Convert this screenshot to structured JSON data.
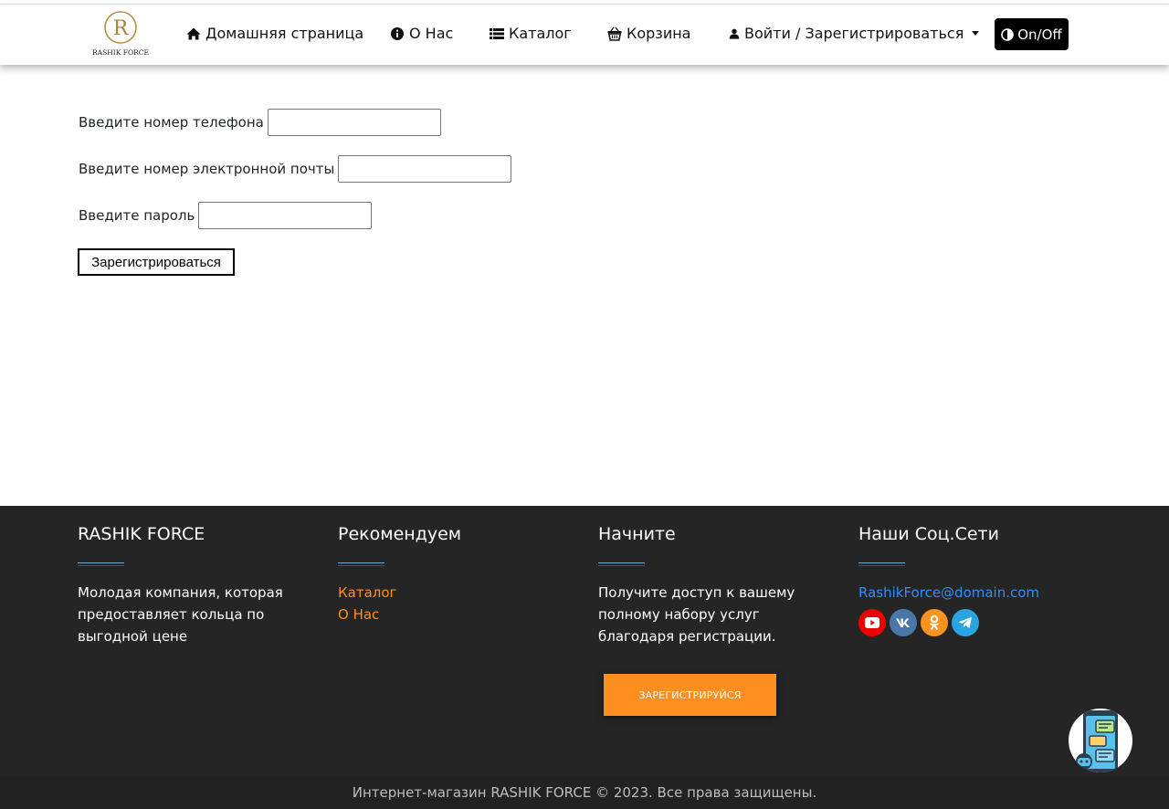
{
  "header": {
    "logo_text": "RASHIK FORCE",
    "nav": [
      {
        "label": "Домашняя страница",
        "icon": "home-icon"
      },
      {
        "label": "О Нас",
        "icon": "info-icon"
      },
      {
        "label": "Каталог",
        "icon": "list-icon"
      },
      {
        "label": "Корзина",
        "icon": "basket-icon"
      },
      {
        "label": "Войти / Зарегистрироваться",
        "icon": "user-icon"
      }
    ],
    "toggle_label": "On/Off"
  },
  "form": {
    "phone_label": "Введите номер телефона",
    "phone_value": "",
    "email_label": "Введите номер электронной почты",
    "email_value": "",
    "password_label": "Введите пароль",
    "password_value": "",
    "submit_label": "Зарегистрироваться"
  },
  "footer": {
    "col1": {
      "title": "RASHIK FORCE",
      "text": "Молодая компания, которая предоставляет кольца по выгодной цене"
    },
    "col2": {
      "title": "Рекомендуем",
      "links": [
        "Каталог",
        "О Нас"
      ]
    },
    "col3": {
      "title": "Начните",
      "text": "Получите доступ к вашему полному набору услуг благодаря регистрации.",
      "cta": "ЗАРЕГИСТРИРУЙСЯ"
    },
    "col4": {
      "title": "Наши Соц.Сети",
      "email": "RashikForce@domain.com",
      "socials": [
        "youtube-icon",
        "vk-icon",
        "odnoklassniki-icon",
        "telegram-icon"
      ]
    },
    "copyright": "Интернет-магазин RASHIK FORCE © 2023. Все права защищены."
  },
  "colors": {
    "accent": "#fd8e1f",
    "link_blue": "#2e8eff",
    "footer_bg": "#252525"
  }
}
